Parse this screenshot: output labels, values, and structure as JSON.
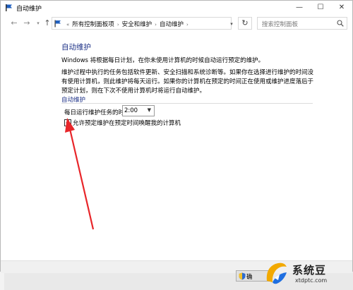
{
  "window": {
    "title": "自动维护",
    "min_glyph": "—",
    "max_glyph": "☐",
    "close_glyph": "✕"
  },
  "nav": {
    "back_glyph": "←",
    "forward_glyph": "→",
    "dropdown_glyph": "▾",
    "up_glyph": "↑",
    "breadcrumb_prefix": "«",
    "breadcrumbs": [
      "所有控制面板项",
      "安全和维护",
      "自动维护"
    ],
    "breadcrumb_separator": "›",
    "refresh_glyph": "↻",
    "search_placeholder": "搜索控制面板"
  },
  "content": {
    "title": "自动维护",
    "intro": "Windows 将根据每日计划，在你未使用计算机的时候自动运行预定的维护。",
    "paragraph": "维护过程中执行的任务包括软件更新、安全扫描和系统诊断等。如果你在选择进行维护的时间没有使用计算机，则此维护将每天运行。如果你的计算机在预定的时间正在使用或维护进度落后于预定计划，则在下次不使用计算机时将运行自动维护。",
    "section_title": "自动维护",
    "time_label": "每日运行维护任务的时间",
    "time_value": "2:00",
    "wake_checkbox_label": "允许预定维护在预定时间唤醒我的计算机",
    "wake_checked": true
  },
  "footer": {
    "ok_label": "确"
  },
  "watermark": {
    "title": "系统豆",
    "url": "xtdptc.com"
  },
  "colors": {
    "heading": "#1e3287",
    "annotation_arrow": "#e8262a"
  }
}
